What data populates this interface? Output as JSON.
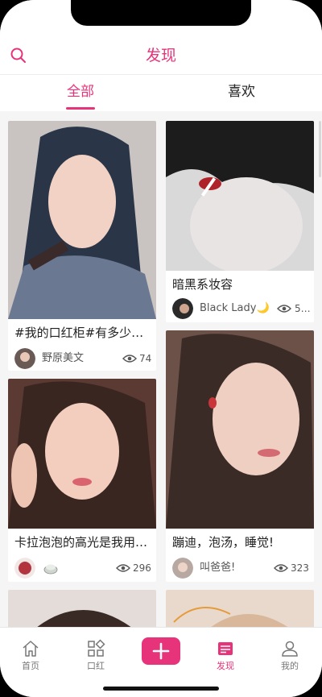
{
  "header": {
    "title": "发现"
  },
  "tabs": [
    {
      "label": "全部",
      "active": true
    },
    {
      "label": "喜欢",
      "active": false
    }
  ],
  "cards": [
    {
      "title": "#我的口红柜#有多少…",
      "author": "野原美文",
      "views": "74"
    },
    {
      "title": "暗黑系妆容",
      "author": "Black Lady🌙",
      "views": "5…"
    },
    {
      "title": "卡拉泡泡的高光是我用…",
      "author": "",
      "views": "296"
    },
    {
      "title": "蹦迪，泡汤，睡觉!",
      "author": "叫爸爸!",
      "views": "323"
    }
  ],
  "nav": [
    {
      "label": "首页",
      "icon": "home-icon"
    },
    {
      "label": "口红",
      "icon": "grid-icon"
    },
    {
      "label": "",
      "icon": "plus-icon"
    },
    {
      "label": "发现",
      "icon": "discover-icon",
      "active": true
    },
    {
      "label": "我的",
      "icon": "user-icon"
    }
  ],
  "colors": {
    "accent": "#e6337a"
  }
}
